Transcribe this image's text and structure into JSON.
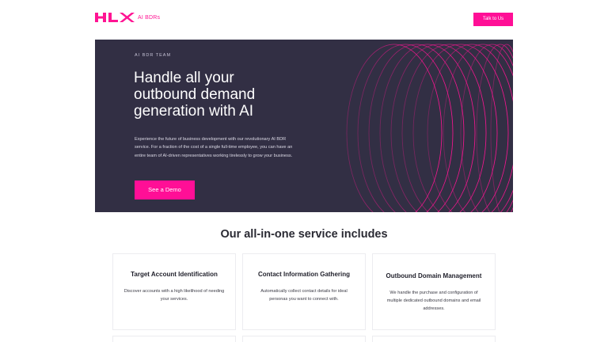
{
  "header": {
    "logo_text": "HLX",
    "logo_sub": "AI BDRs",
    "cta_label": "Talk to Us"
  },
  "hero": {
    "eyebrow": "AI BDR TEAM",
    "title": "Handle all your outbound demand generation with AI",
    "body": "Experience the future of business development with our revolutionary AI BDR service. For a fraction of the cost of a single full-time employee, you can have an entire team of AI-driven representatives working tirelessly to grow your business.",
    "cta_label": "See a Demo"
  },
  "services": {
    "title": "Our all-in-one service includes",
    "cards": [
      {
        "title": "Target Account Identification",
        "body": "Discover accounts with a high likelihood of needing your services."
      },
      {
        "title": "Contact Information Gathering",
        "body": "Automatically collect contact details for ideal personas you want to connect with."
      },
      {
        "title": "Outbound Domain Management",
        "body": "We handle the purchase and configuration of multiple dedicated outbound domains and email addresses."
      }
    ]
  },
  "colors": {
    "accent": "#ff0f96",
    "hero_bg": "#322f44"
  },
  "icons": {
    "logo": "hlx-logo-mark",
    "decoration": "concentric-rings-graphic"
  }
}
